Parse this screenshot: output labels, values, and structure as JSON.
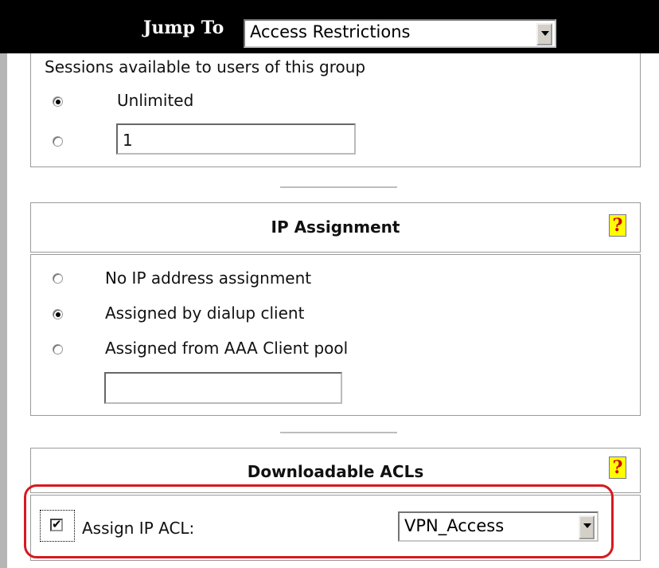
{
  "jump": {
    "label": "Jump To",
    "selected": "Access Restrictions"
  },
  "sessions": {
    "label": "Sessions available to users of this group",
    "options": [
      {
        "label": "Unlimited",
        "selected": true
      },
      {
        "selected": false
      }
    ],
    "count_value": "1"
  },
  "ip_assignment": {
    "title": "IP Assignment",
    "options": [
      {
        "label": "No IP address assignment",
        "selected": false
      },
      {
        "label": "Assigned by dialup client",
        "selected": true
      },
      {
        "label": "Assigned from AAA Client pool",
        "selected": false
      }
    ],
    "pool_value": ""
  },
  "downloadable_acls": {
    "title": "Downloadable ACLs",
    "assign_label": "Assign IP ACL:",
    "assign_checked": true,
    "acl_selected": "VPN_Access"
  },
  "help_glyph": "?"
}
